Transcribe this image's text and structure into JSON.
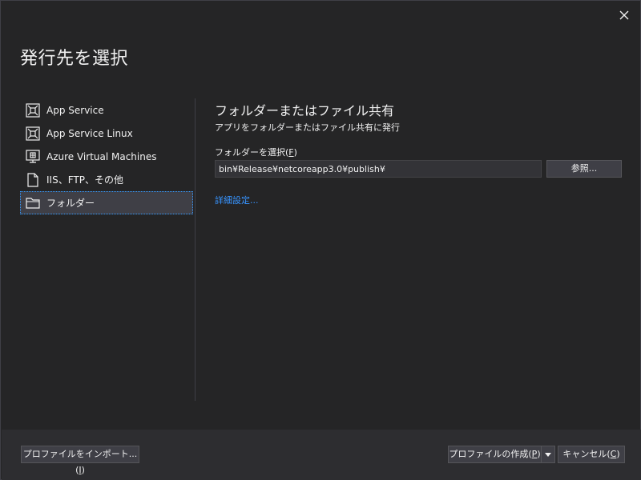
{
  "dialog": {
    "title": "発行先を選択",
    "close_label": "close"
  },
  "sidebar": {
    "items": [
      {
        "label": "App Service",
        "icon": "app-service-icon"
      },
      {
        "label": "App Service Linux",
        "icon": "app-service-linux-icon"
      },
      {
        "label": "Azure Virtual Machines",
        "icon": "virtual-machine-icon"
      },
      {
        "label": "IIS、FTP、その他",
        "icon": "document-icon"
      },
      {
        "label": "フォルダー",
        "icon": "folder-icon",
        "selected": true
      }
    ]
  },
  "content": {
    "title": "フォルダーまたはファイル共有",
    "subtitle": "アプリをフォルダーまたはファイル共有に発行",
    "folder_label": "フォルダーを選択(",
    "folder_label_key": "F",
    "folder_label_end": ")",
    "folder_value": "bin¥Release¥netcoreapp3.0¥publish¥",
    "browse_label": "参照...",
    "advanced_link": "詳細設定..."
  },
  "footer": {
    "import_label": "プロファイルをインポート...(",
    "import_key": "I",
    "import_end": ")",
    "create_label": "プロファイルの作成(",
    "create_key": "P",
    "create_end": ")",
    "cancel_label": "キャンセル(",
    "cancel_key": "C",
    "cancel_end": ")"
  },
  "colors": {
    "background": "#252526",
    "footer": "#2d2d30",
    "accent_link": "#3794ff",
    "selection_border": "#3399ff",
    "icon": "#f1f1f1"
  }
}
